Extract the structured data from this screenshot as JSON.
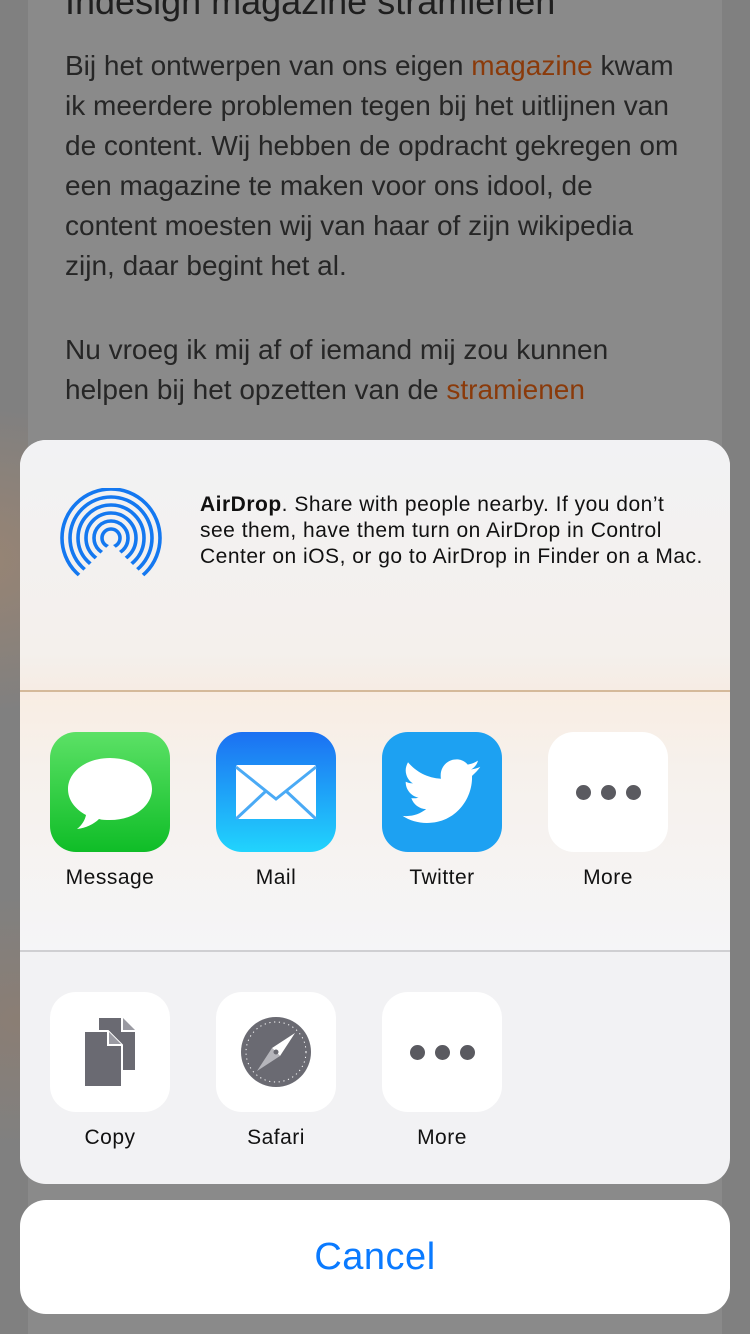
{
  "background_page": {
    "heading": "Indesign magazine stramienen",
    "paragraph1_before": "Bij het ontwerpen van ons eigen ",
    "paragraph1_link": "magazine",
    "paragraph1_after": " kwam ik meerdere problemen tegen bij het uitlijnen van de content. Wij hebben de opdracht gekregen om een magazine te maken voor ons idool, de content moesten wij van haar of zijn wikipedia zijn, daar begint het al.",
    "paragraph2": "Nu vroeg ik mij af of iemand mij zou kunnen",
    "paragraph3_before": "helpen bij het opzetten van de ",
    "paragraph3_link": "stramienen"
  },
  "airdrop": {
    "icon": "airdrop-icon",
    "title": "AirDrop",
    "description": ". Share with people nearby. If you don’t see them, have them turn on AirDrop in Control Center on iOS, or go to AirDrop in Finder on a Mac."
  },
  "share_apps": [
    {
      "label": "Message",
      "icon": "message-icon",
      "color": "#1ec53a"
    },
    {
      "label": "Mail",
      "icon": "mail-icon",
      "color": "#1f8ff7"
    },
    {
      "label": "Twitter",
      "icon": "twitter-icon",
      "color": "#1da1f2"
    },
    {
      "label": "More",
      "icon": "more-icon"
    }
  ],
  "actions": [
    {
      "label": "Copy",
      "icon": "copy-icon"
    },
    {
      "label": "Safari",
      "icon": "safari-icon"
    },
    {
      "label": "More",
      "icon": "more-icon"
    }
  ],
  "cancel": {
    "label": "Cancel",
    "color": "#0a7aff"
  },
  "colors": {
    "link_orange": "#c4621e",
    "airdrop_blue": "#1478f0"
  }
}
